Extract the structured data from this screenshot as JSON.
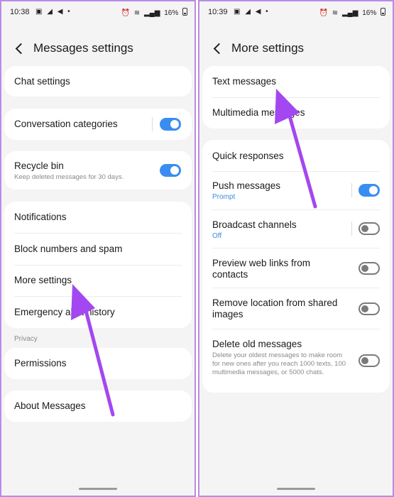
{
  "left": {
    "status": {
      "time": "10:38",
      "icons": "▣ ◢ ◀ •",
      "battery": "16%"
    },
    "title": "Messages settings",
    "items": {
      "chat_settings": {
        "label": "Chat settings"
      },
      "conversation_categories": {
        "label": "Conversation categories",
        "toggle": true
      },
      "recycle_bin": {
        "label": "Recycle bin",
        "sub": "Keep deleted messages for 30 days.",
        "toggle": true
      },
      "notifications": {
        "label": "Notifications"
      },
      "block_numbers": {
        "label": "Block numbers and spam"
      },
      "more_settings": {
        "label": "More settings"
      },
      "emergency": {
        "label": "Emergency alert history"
      },
      "privacy_label": "Privacy",
      "permissions": {
        "label": "Permissions"
      },
      "about": {
        "label": "About Messages"
      }
    }
  },
  "right": {
    "status": {
      "time": "10:39",
      "icons": "▣ ◢ ◀ •",
      "battery": "16%"
    },
    "title": "More settings",
    "items": {
      "text_messages": {
        "label": "Text messages"
      },
      "multimedia_messages": {
        "label": "Multimedia messages"
      },
      "quick_responses": {
        "label": "Quick responses"
      },
      "push_messages": {
        "label": "Push messages",
        "sub": "Prompt",
        "toggle": true
      },
      "broadcast_channels": {
        "label": "Broadcast channels",
        "sub": "Off",
        "toggle": false
      },
      "preview_links": {
        "label": "Preview web links from contacts",
        "toggle": false
      },
      "remove_location": {
        "label": "Remove location from shared images",
        "toggle": false
      },
      "delete_old": {
        "label": "Delete old messages",
        "sub": "Delete your oldest messages to make room for new ones after you reach 1000 texts, 100 multimedia messages, or 5000 chats.",
        "toggle": false
      }
    }
  },
  "colors": {
    "accent": "#3a8df0",
    "arrow": "#a347f0",
    "frame": "#b98be6"
  }
}
